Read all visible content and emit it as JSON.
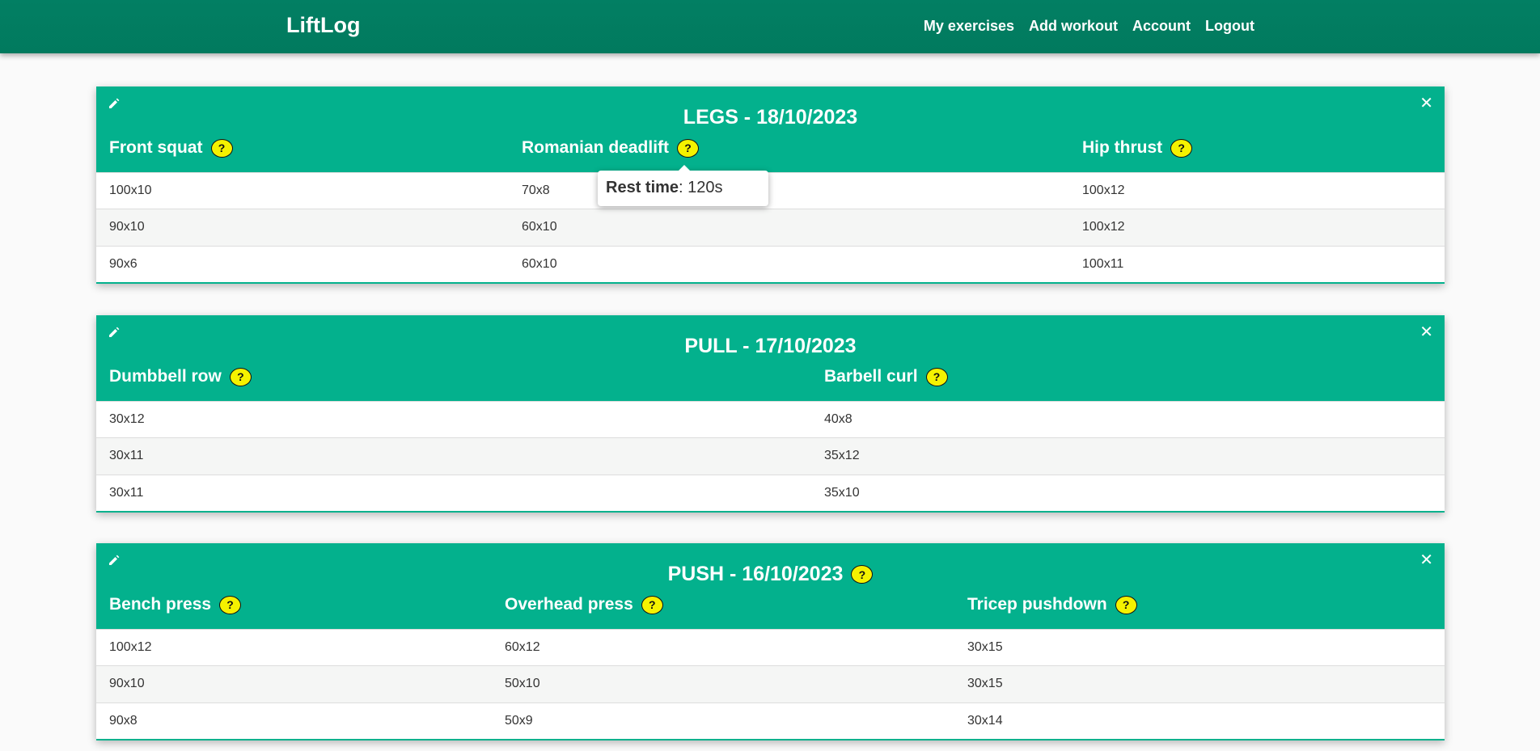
{
  "nav": {
    "brand": "LiftLog",
    "links": [
      "My exercises",
      "Add workout",
      "Account",
      "Logout"
    ]
  },
  "tooltip": {
    "label": "Rest time",
    "value": ": 120s"
  },
  "workouts": [
    {
      "title": "LEGS - 18/10/2023",
      "exercises": [
        "Front squat",
        "Romanian deadlift",
        "Hip thrust"
      ],
      "rows": [
        [
          "100x10",
          "70x8",
          "100x12"
        ],
        [
          "90x10",
          "60x10",
          "100x12"
        ],
        [
          "90x6",
          "60x10",
          "100x11"
        ]
      ]
    },
    {
      "title": "PULL - 17/10/2023",
      "exercises": [
        "Dumbbell row",
        "Barbell curl"
      ],
      "rows": [
        [
          "30x12",
          "40x8"
        ],
        [
          "30x11",
          "35x12"
        ],
        [
          "30x11",
          "35x10"
        ]
      ]
    },
    {
      "title": "PUSH - 16/10/2023",
      "exercises": [
        "Bench press",
        "Overhead press",
        "Tricep pushdown"
      ],
      "rows": [
        [
          "100x12",
          "60x12",
          "30x15"
        ],
        [
          "90x10",
          "50x10",
          "30x15"
        ],
        [
          "90x8",
          "50x9",
          "30x14"
        ]
      ]
    }
  ]
}
